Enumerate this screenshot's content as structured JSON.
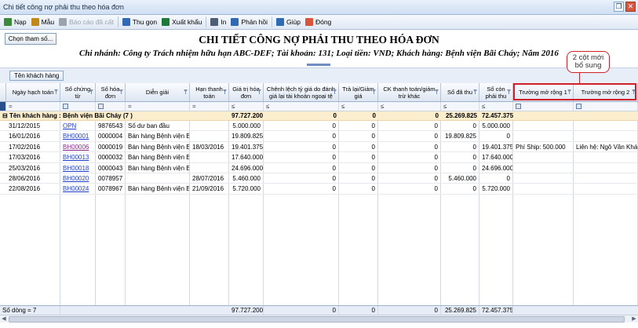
{
  "window": {
    "title": "Chi tiết công nợ phải thu theo hóa đơn"
  },
  "toolbar": {
    "items": [
      {
        "label": "Nạp",
        "icon": "refresh-icon",
        "color": "#3a8a3a",
        "enabled": true
      },
      {
        "label": "Mẫu",
        "icon": "template-icon",
        "color": "#c08a1a",
        "enabled": true
      },
      {
        "label": "Báo cáo đã cất",
        "icon": "saved-report-icon",
        "color": "#9aa3ae",
        "enabled": false
      },
      {
        "label": "Thu gọn",
        "icon": "collapse-icon",
        "color": "#2f6ab3",
        "enabled": true
      },
      {
        "label": "Xuất khẩu",
        "icon": "excel-icon",
        "color": "#1f7a3a",
        "enabled": true
      },
      {
        "label": "In",
        "icon": "printer-icon",
        "color": "#4d5e77",
        "enabled": true
      },
      {
        "label": "Phản hồi",
        "icon": "feedback-icon",
        "color": "#2f6ab3",
        "enabled": true
      },
      {
        "label": "Giúp",
        "icon": "help-icon",
        "color": "#2f6ab3",
        "enabled": true
      },
      {
        "label": "Đóng",
        "icon": "close-icon",
        "color": "#d9553e",
        "enabled": true
      }
    ]
  },
  "chon_tham_so": "Chọn tham số...",
  "report": {
    "title": "CHI TIẾT CÔNG NỢ PHẢI THU THEO HÓA ĐƠN",
    "subtitle": "Chi nhánh: Công ty Trách nhiệm hữu hạn ABC-DEF; Tài khoản: 131; Loại tiền: VND; Khách hàng: Bệnh viện Bãi Cháy; Năm 2016"
  },
  "group_chip": "Tên khách hàng",
  "columns": [
    "Ngày hạch toán",
    "Số chứng từ",
    "Số hóa đơn",
    "Diễn giải",
    "Hạn thanh toán",
    "Giá trị hóa đơn",
    "Chênh lệch tỷ giá do đánh giá lại tài khoản ngoại tệ",
    "Trả lại/Giảm giá",
    "CK thanh toán/giảm trừ khác",
    "Số đã thu",
    "Số còn phải thu",
    "Trường mở rộng 1",
    "Trường mở rộng 2"
  ],
  "filter": {
    "eq": "=",
    "le": "≤"
  },
  "group_row": {
    "label": "Tên khách hàng : Bệnh viện Bãi Cháy (7 )",
    "gia_tri": "97.727.200",
    "chenh_lech": "0",
    "tra_lai": "0",
    "ck": "0",
    "da_thu": "25.269.825",
    "con_phai_thu": "72.457.375"
  },
  "rows": [
    {
      "ngay": "31/12/2015",
      "so_ct": "OPN",
      "so_hd": "9876543",
      "dien_giai": "Số dư ban đầu",
      "han": "",
      "gia_tri": "5.000.000",
      "cl": "0",
      "tl": "0",
      "ck": "0",
      "da_thu": "0",
      "con": "5.000.000",
      "m1": "",
      "m2": "",
      "visited": false
    },
    {
      "ngay": "16/01/2016",
      "so_ct": "BH00001",
      "so_hd": "0000004",
      "dien_giai": "Bán hàng Bệnh viện B",
      "han": "",
      "gia_tri": "19.809.825",
      "cl": "0",
      "tl": "0",
      "ck": "0",
      "da_thu": "19.809.825",
      "con": "0",
      "m1": "",
      "m2": "",
      "visited": false
    },
    {
      "ngay": "17/02/2016",
      "so_ct": "BH00006",
      "so_hd": "0000019",
      "dien_giai": "Bán hàng Bệnh viện B",
      "han": "18/03/2016",
      "gia_tri": "19.401.375",
      "cl": "0",
      "tl": "0",
      "ck": "0",
      "da_thu": "0",
      "con": "19.401.375",
      "m1": "Phí Ship: 500.000",
      "m2": "Liên hệ: Ngô Văn Khán",
      "visited": true
    },
    {
      "ngay": "17/03/2016",
      "so_ct": "BH00013",
      "so_hd": "0000032",
      "dien_giai": "Bán hàng Bệnh viện B",
      "han": "",
      "gia_tri": "17.640.000",
      "cl": "0",
      "tl": "0",
      "ck": "0",
      "da_thu": "0",
      "con": "17.640.000",
      "m1": "",
      "m2": "",
      "visited": false
    },
    {
      "ngay": "25/03/2016",
      "so_ct": "BH00018",
      "so_hd": "0000043",
      "dien_giai": "Bán hàng Bệnh viện B",
      "han": "",
      "gia_tri": "24.696.000",
      "cl": "0",
      "tl": "0",
      "ck": "0",
      "da_thu": "0",
      "con": "24.696.000",
      "m1": "",
      "m2": "",
      "visited": false
    },
    {
      "ngay": "28/06/2016",
      "so_ct": "BH00020",
      "so_hd": "0078957",
      "dien_giai": "",
      "han": "28/07/2016",
      "gia_tri": "5.460.000",
      "cl": "0",
      "tl": "0",
      "ck": "0",
      "da_thu": "5.460.000",
      "con": "0",
      "m1": "",
      "m2": "",
      "visited": false
    },
    {
      "ngay": "22/08/2016",
      "so_ct": "BH00024",
      "so_hd": "0078967",
      "dien_giai": "Bán hàng Bệnh viện B",
      "han": "21/09/2016",
      "gia_tri": "5.720.000",
      "cl": "0",
      "tl": "0",
      "ck": "0",
      "da_thu": "0",
      "con": "5.720.000",
      "m1": "",
      "m2": "",
      "visited": false
    }
  ],
  "footer": {
    "count": "Số dòng = 7",
    "gia_tri": "97.727.200",
    "cl": "0",
    "tl": "0",
    "ck": "0",
    "da_thu": "25.269.825",
    "con": "72.457.375"
  },
  "callout": {
    "line1": "2 cột mới",
    "line2": "bổ sung"
  }
}
